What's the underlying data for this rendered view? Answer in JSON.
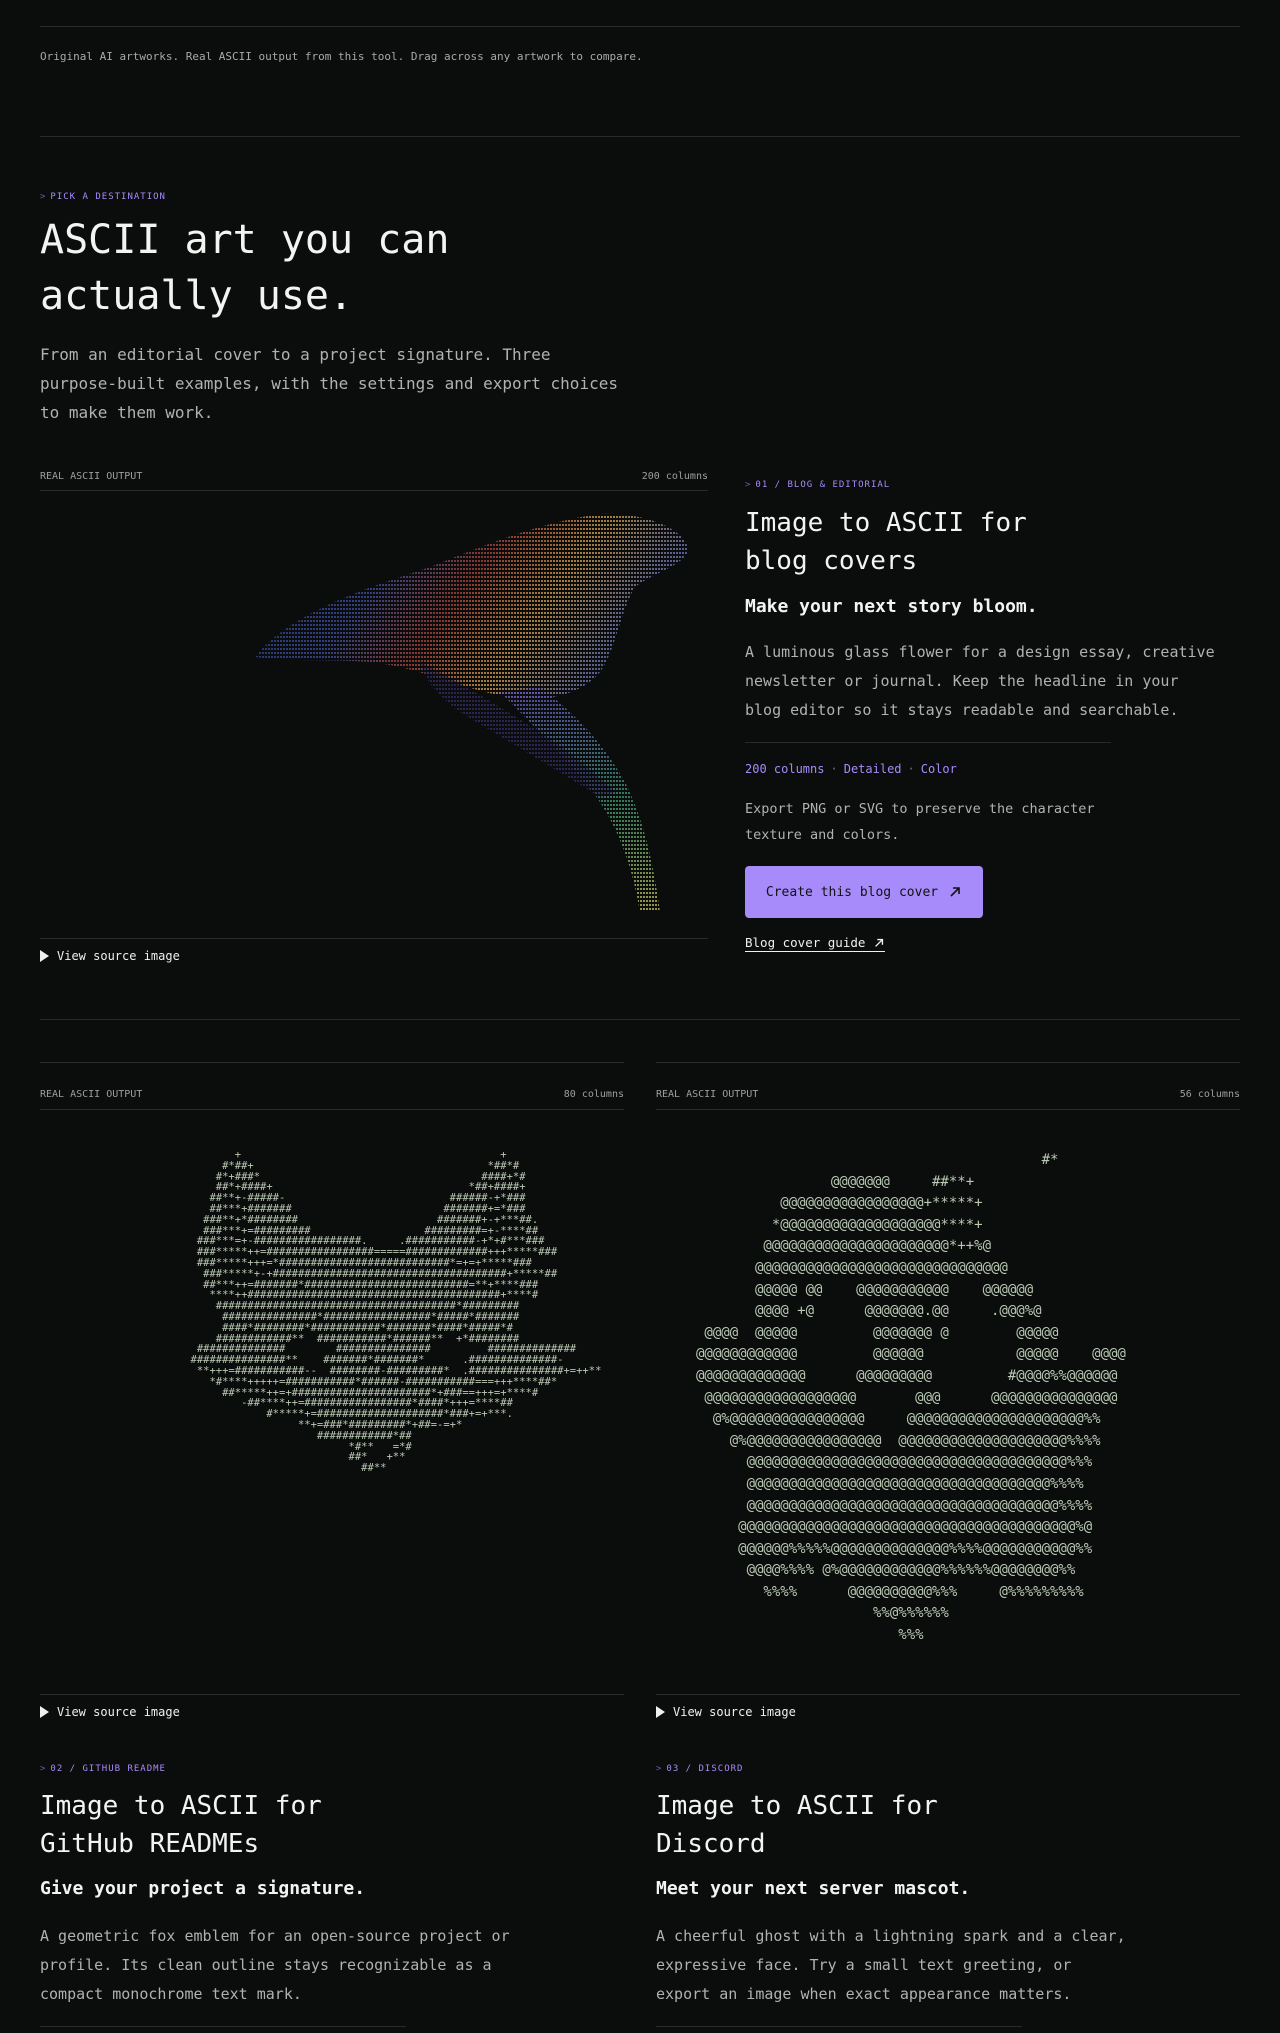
{
  "caption": "Original AI artworks. Real ASCII output from this tool. Drag across any artwork to compare.",
  "hero": {
    "kicker": "PICK A DESTINATION",
    "title": "ASCII art you can actually use.",
    "description": "From an editorial cover to a project signature. Three purpose-built examples, with the settings and export choices to make them work."
  },
  "blog": {
    "panel_label": "REAL ASCII OUTPUT",
    "columns": "200 columns",
    "view_source": "View source image",
    "kicker": "01 / BLOG & EDITORIAL",
    "title": "Image to ASCII for blog covers",
    "subtitle": "Make your next story bloom.",
    "description": "A luminous glass flower for a design essay, creative newsletter or journal. Keep the headline in your blog editor so it stays readable and searchable.",
    "meta": [
      "200 columns",
      "Detailed",
      "Color"
    ],
    "note": "Export PNG or SVG to preserve the character texture and colors.",
    "cta_label": "Create this blog cover",
    "guide_label": "Blog cover guide"
  },
  "github": {
    "panel_label": "REAL ASCII OUTPUT",
    "columns": "80 columns",
    "view_source": "View source image",
    "kicker": "02 / GITHUB README",
    "title": "Image to ASCII for GitHub READMEs",
    "subtitle": "Give your project a signature.",
    "description": "A geometric fox emblem for an open-source project or profile. Its clean outline stays recognizable as a compact monochrome text mark."
  },
  "discord": {
    "panel_label": "REAL ASCII OUTPUT",
    "columns": "56 columns",
    "view_source": "View source image",
    "kicker": "03 / DISCORD",
    "title": "Image to ASCII for Discord",
    "subtitle": "Meet your next server mascot.",
    "description": "A cheerful ghost with a lightning spark and a clear, expressive face. Try a small text greeting, or export an image when exact appearance matters."
  },
  "colors": {
    "accent": "#a78bfa",
    "background": "#0b0c0c",
    "ascii_green": "#b9c9b4"
  },
  "icons": {
    "arrow": "arrow-up-right-icon",
    "disclosure": "triangle-right-icon"
  }
}
